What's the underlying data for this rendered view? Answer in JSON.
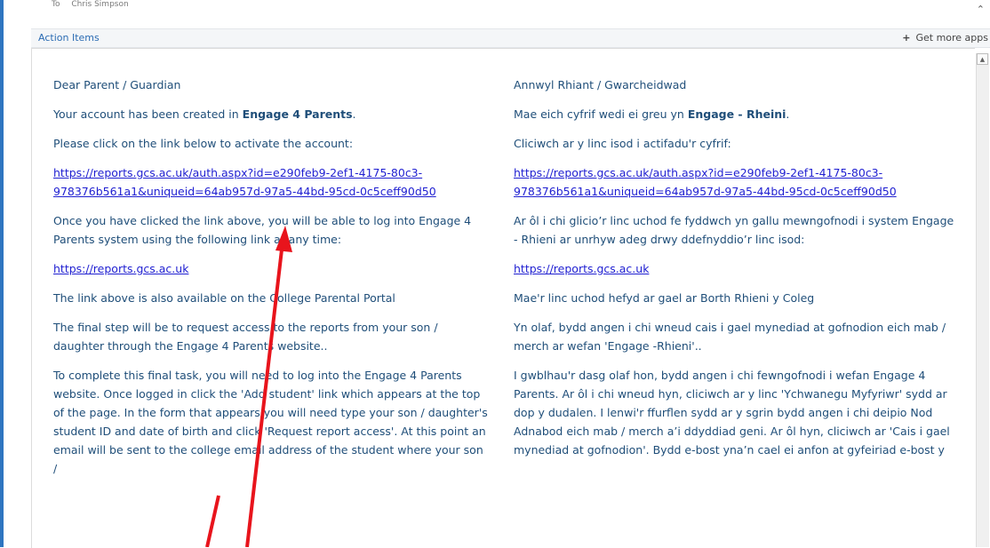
{
  "email_header": {
    "to_label": "To",
    "to_name": "Chris Simpson"
  },
  "action_bar": {
    "label": "Action Items",
    "get_apps": "Get more apps"
  },
  "left": {
    "greeting": "Dear Parent / Guardian",
    "created_pre": "Your account has been created in ",
    "created_bold": "Engage 4 Parents",
    "created_post": ".",
    "click_below": "Please click on the link below to activate the account:",
    "activation_link_1": "https://reports.gcs.ac.uk/auth.aspx?id=e290feb9-2ef1-4175-80c3-",
    "activation_link_2": "978376b561a1&uniqueid=64ab957d-97a5-44bd-95cd-0c5ceff90d50",
    "once_clicked_1": "Once you have clicked the link above, you will be able to log into Engage 4",
    "once_clicked_2": "Parents system using the following link at any time:",
    "reports_link": "https://reports.gcs.ac.uk",
    "portal": "The link above is also available on the College Parental Portal",
    "final_step_1": "The final step will be to request access to the reports from your son /",
    "final_step_2": "daughter through the Engage 4 Parents website..",
    "complete_1": "To complete this final task, you will need to log into the Engage 4 Parents",
    "complete_2": "website. Once logged in click the 'Add student' link which appears at the top",
    "complete_3": "of the page. In the form that appears you will need type your son / daughter's",
    "complete_4": "student ID and date of birth and click 'Request report access'. At this point an",
    "complete_5": "email will be sent to the college email address of the student where your son /"
  },
  "right": {
    "greeting": "Annwyl Rhiant / Gwarcheidwad",
    "created_pre": "Mae eich cyfrif wedi ei greu yn ",
    "created_bold": "Engage - Rheini",
    "created_post": ".",
    "click_below": "Cliciwch ar y linc isod i actifadu'r cyfrif:",
    "activation_link_1": "https://reports.gcs.ac.uk/auth.aspx?id=e290feb9-2ef1-4175-80c3-",
    "activation_link_2": "978376b561a1&uniqueid=64ab957d-97a5-44bd-95cd-0c5ceff90d50",
    "once_clicked_1": "Ar ôl i chi glicio’r linc uchod fe fyddwch yn gallu mewngofnodi i system Engage",
    "once_clicked_2": "- Rhieni ar unrhyw adeg drwy ddefnyddio’r linc isod:",
    "reports_link": "https://reports.gcs.ac.uk",
    "portal": "Mae'r linc uchod hefyd ar gael ar Borth Rhieni y Coleg",
    "final_step_1": "Yn olaf, bydd angen i chi wneud cais i gael mynediad at gofnodion eich mab /",
    "final_step_2": "merch ar wefan 'Engage -Rhieni'..",
    "complete_1": "I gwblhau'r dasg olaf hon, bydd angen i chi fewngofnodi i wefan Engage 4",
    "complete_2": "Parents. Ar ôl i chi wneud hyn, cliciwch ar y linc 'Ychwanegu Myfyriwr' sydd ar",
    "complete_3": "dop y dudalen. I lenwi'r ffurflen sydd ar y sgrin bydd angen i chi deipio Nod",
    "complete_4": "Adnabod eich mab / merch a’i ddyddiad geni. Ar ôl hyn, cliciwch ar 'Cais i gael",
    "complete_5": "mynediad at gofnodion'. Bydd e-bost yna’n cael ei anfon at gyfeiriad e-bost y"
  },
  "colors": {
    "text": "#1f4e79",
    "link": "#1f1fd1",
    "arrow": "#e8141c",
    "accent_edge": "#2e75c0"
  }
}
